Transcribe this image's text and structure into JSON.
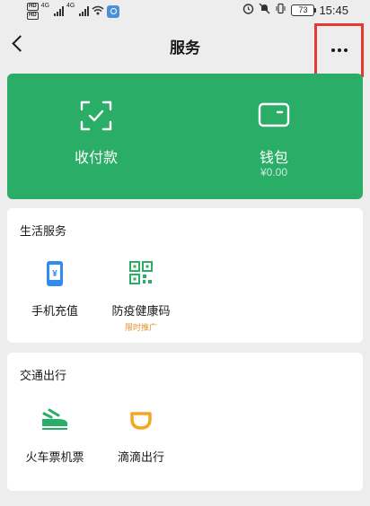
{
  "status_bar": {
    "hd_badges": [
      "HD",
      "HD"
    ],
    "network_labels": [
      "4G",
      "4G"
    ],
    "battery_level": "73",
    "time": "15:45"
  },
  "nav": {
    "title": "服务"
  },
  "wallet_card": {
    "background_color": "#2aae67",
    "pay_label": "收付款",
    "wallet_label": "钱包",
    "balance": "¥0.00"
  },
  "life_services": {
    "title": "生活服务",
    "items": [
      {
        "label": "手机充值",
        "icon": "phone-recharge-icon",
        "color": "#2f8bf0"
      },
      {
        "label": "防疫健康码",
        "icon": "qr-code-icon",
        "color": "#2aae67",
        "tag": "限时推广"
      }
    ]
  },
  "traffic_services": {
    "title": "交通出行",
    "items": [
      {
        "label": "火车票机票",
        "icon": "train-icon",
        "color": "#2aae67"
      },
      {
        "label": "滴滴出行",
        "icon": "didi-icon",
        "color": "#f5a623"
      }
    ]
  },
  "highlight_color": "#e53935"
}
